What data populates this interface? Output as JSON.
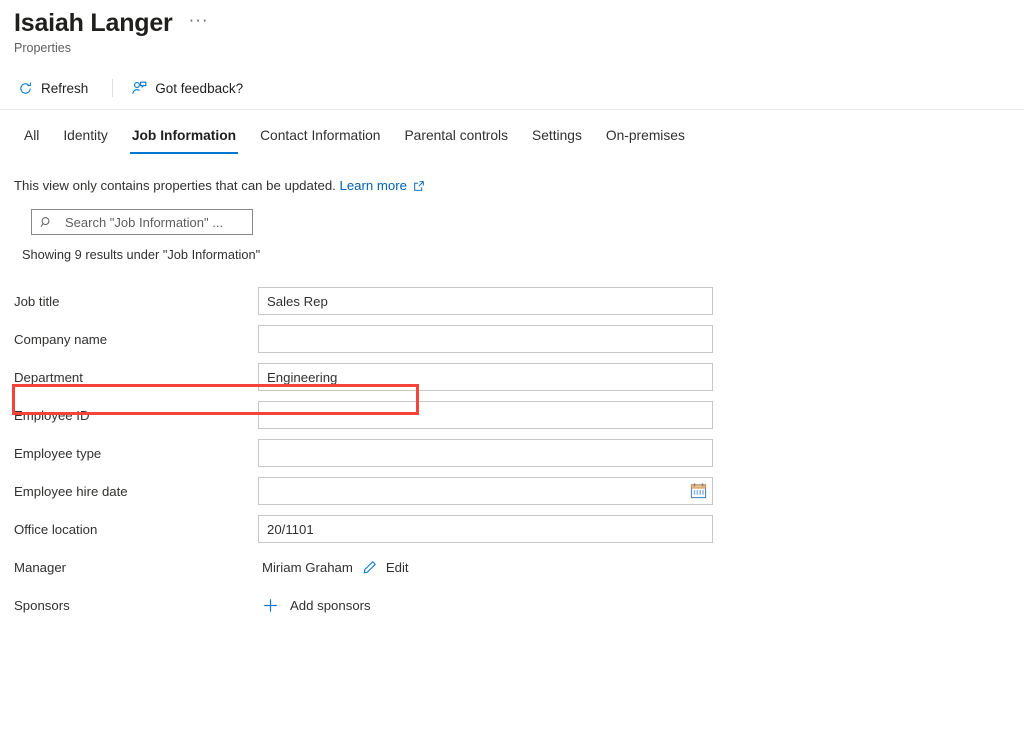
{
  "header": {
    "title": "Isaiah Langer",
    "subtitle": "Properties",
    "more_label": "···"
  },
  "commandbar": {
    "refresh_label": "Refresh",
    "refresh_icon": "refresh-icon",
    "feedback_label": "Got feedback?",
    "feedback_icon": "feedback-person-icon"
  },
  "tabs": [
    {
      "label": "All",
      "active": false
    },
    {
      "label": "Identity",
      "active": false
    },
    {
      "label": "Job Information",
      "active": true
    },
    {
      "label": "Contact Information",
      "active": false
    },
    {
      "label": "Parental controls",
      "active": false
    },
    {
      "label": "Settings",
      "active": false
    },
    {
      "label": "On-premises",
      "active": false
    }
  ],
  "info": {
    "text": "This view only contains properties that can be updated.",
    "link_label": "Learn more",
    "link_icon": "external-link-icon"
  },
  "search": {
    "placeholder": "Search \"Job Information\" ...",
    "value": "",
    "icon": "search-icon"
  },
  "results": {
    "text": "Showing 9 results under \"Job Information\""
  },
  "fields": [
    {
      "label": "Job title",
      "value": "Sales Rep",
      "type": "input"
    },
    {
      "label": "Company name",
      "value": "",
      "type": "input"
    },
    {
      "label": "Department",
      "value": "Engineering",
      "type": "input",
      "highlighted": true
    },
    {
      "label": "Employee ID",
      "value": "",
      "type": "input"
    },
    {
      "label": "Employee type",
      "value": "",
      "type": "input"
    },
    {
      "label": "Employee hire date",
      "value": "",
      "type": "date",
      "icon": "calendar-icon"
    },
    {
      "label": "Office location",
      "value": "20/1101",
      "type": "input"
    }
  ],
  "manager": {
    "label": "Manager",
    "value": "Miriam Graham",
    "edit_label": "Edit",
    "edit_icon": "pencil-icon"
  },
  "sponsors": {
    "label": "Sponsors",
    "add_label": "Add sponsors",
    "add_icon": "plus-icon"
  },
  "colors": {
    "accent": "#0078d4",
    "link": "#0063b1",
    "highlight": "#f4433a",
    "text": "#323130",
    "border": "#c8c6c4"
  }
}
